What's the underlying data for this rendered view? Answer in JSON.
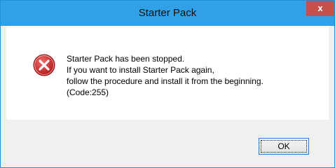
{
  "window": {
    "title": "Starter Pack",
    "close_label": "x"
  },
  "dialog": {
    "icon": "error-icon",
    "message_lines": [
      "Starter Pack has been stopped.",
      "If you want to install Starter Pack again,",
      "follow the procedure and install it from the beginning.",
      "(Code:255)"
    ]
  },
  "buttons": {
    "ok_label": "OK"
  },
  "colors": {
    "title_bar": "#32a0e6",
    "close_button": "#c7504a",
    "error_icon": "#d12a2a"
  }
}
